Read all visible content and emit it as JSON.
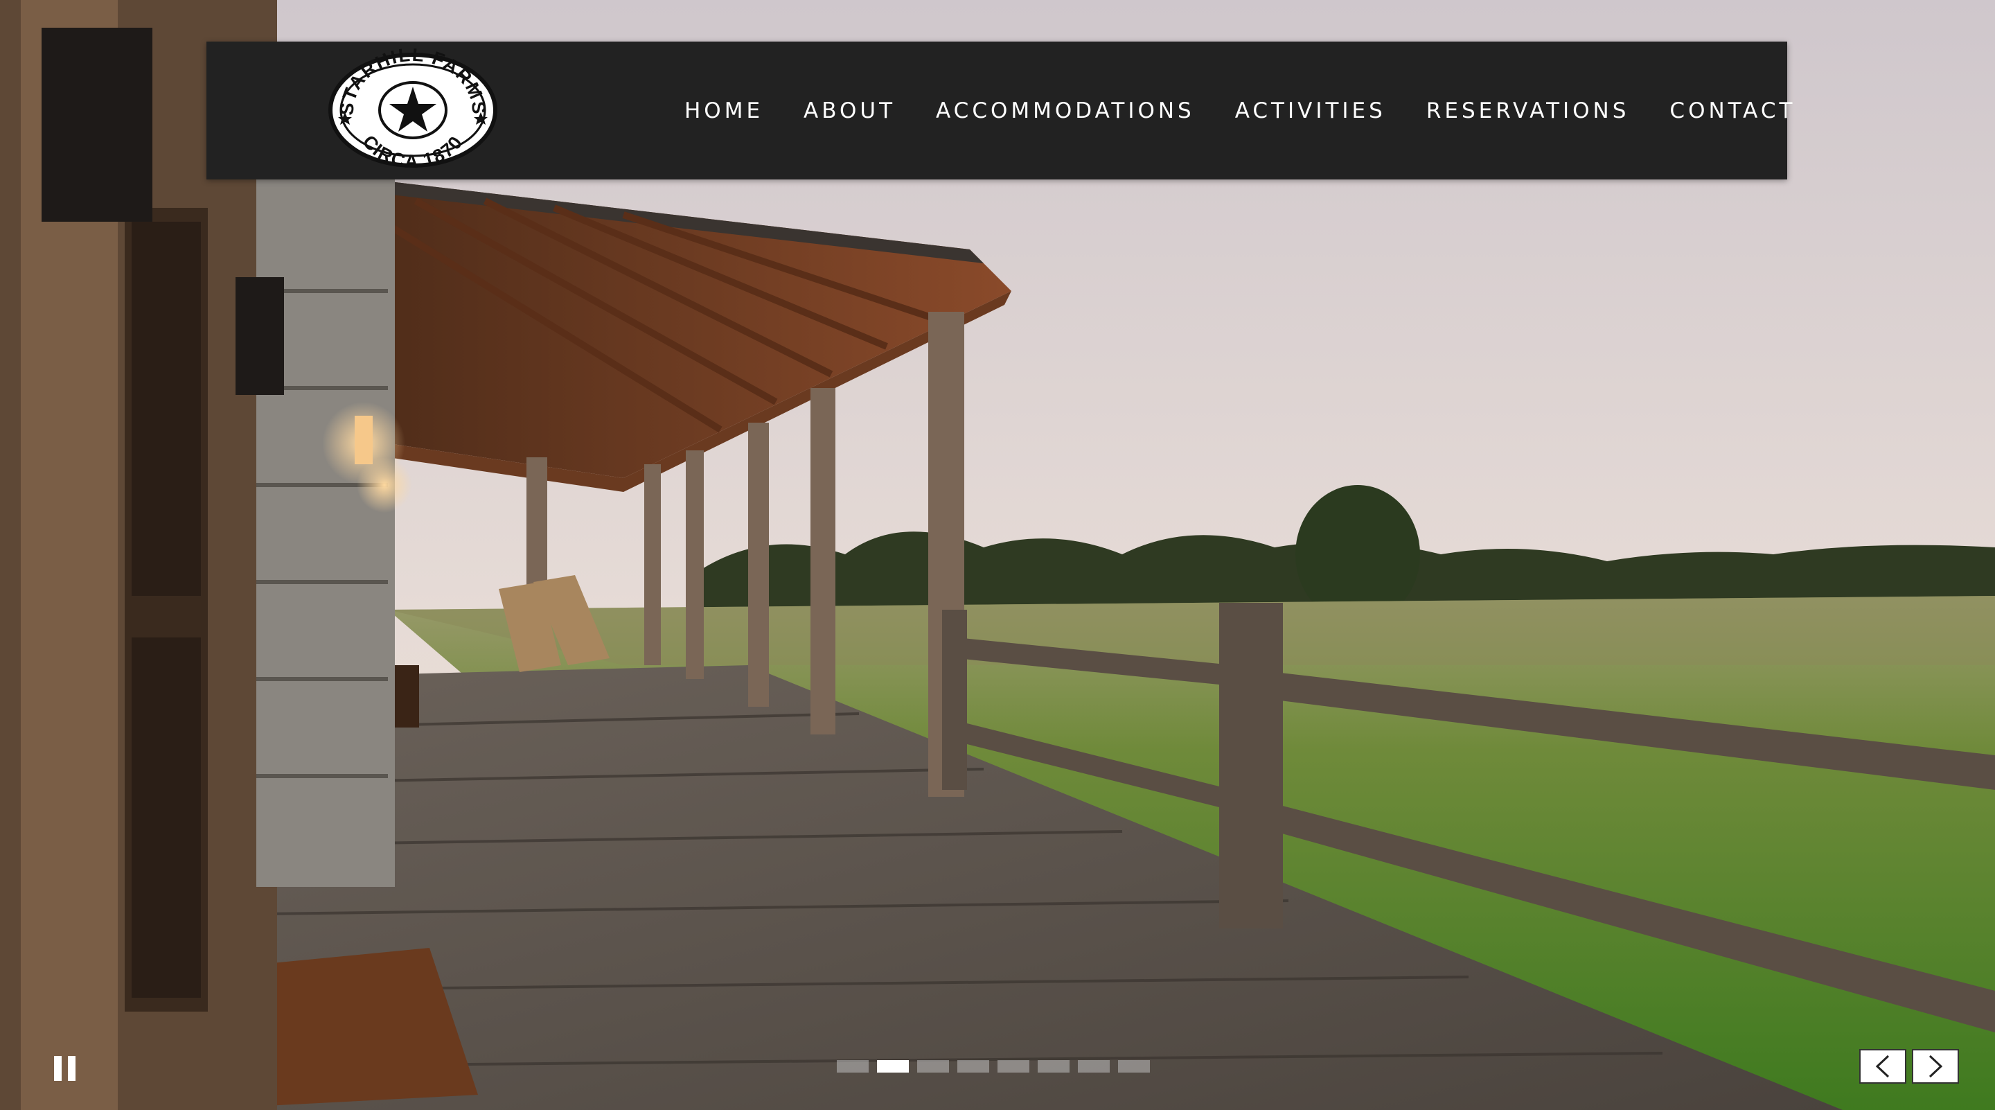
{
  "brand": {
    "name_top": "STARHILL FARMS",
    "name_bottom": "CIRCA 1870"
  },
  "nav": {
    "items": [
      {
        "label": "HOME"
      },
      {
        "label": "ABOUT"
      },
      {
        "label": "ACCOMMODATIONS"
      },
      {
        "label": "ACTIVITIES"
      },
      {
        "label": "RESERVATIONS"
      },
      {
        "label": "CONTACT"
      }
    ]
  },
  "slider": {
    "slide_count": 8,
    "active_index": 1,
    "controls": {
      "pause_icon": "pause-icon",
      "prev_icon": "chevron-left-icon",
      "next_icon": "chevron-right-icon"
    }
  },
  "colors": {
    "navbar_bg": "#222222",
    "nav_text": "#ffffff",
    "dot_active": "#ffffff",
    "dot_inactive": "#bebebe"
  }
}
